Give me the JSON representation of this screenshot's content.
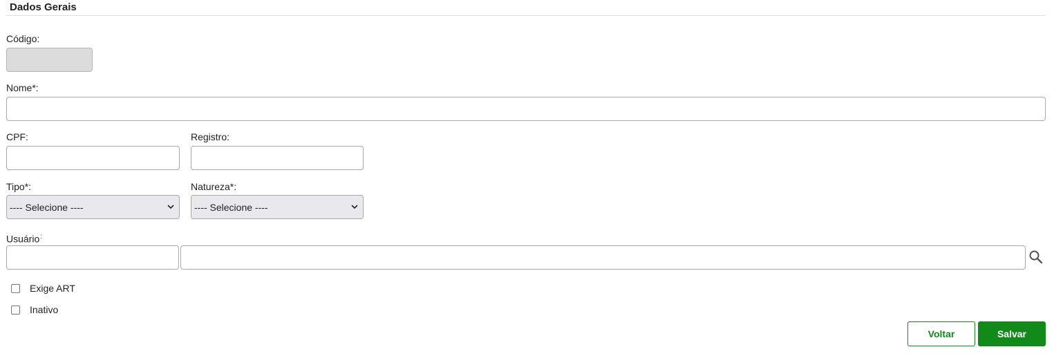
{
  "section": {
    "title": "Dados Gerais"
  },
  "form": {
    "codigo": {
      "label": "Código:",
      "value": ""
    },
    "nome": {
      "label": "Nome*:",
      "value": ""
    },
    "cpf": {
      "label": "CPF:",
      "value": ""
    },
    "registro": {
      "label": "Registro:",
      "value": ""
    },
    "tipo": {
      "label": "Tipo*:",
      "selected": "---- Selecione ----"
    },
    "natureza": {
      "label": "Natureza*:",
      "selected": "---- Selecione ----"
    },
    "usuario": {
      "label": "Usuário",
      "label_suffix": ":",
      "code_value": "",
      "name_value": ""
    },
    "exige_art": {
      "label": "Exige ART",
      "checked": false
    },
    "inativo": {
      "label": "Inativo",
      "checked": false
    }
  },
  "actions": {
    "back_label": "Voltar",
    "save_label": "Salvar"
  },
  "icons": {
    "search": "search-icon",
    "select_arrow": "chevron-down-icon"
  },
  "colors": {
    "primary_green": "#118a1a",
    "disabled_bg": "#dcdcdc",
    "select_bg": "#e9e9ed"
  }
}
